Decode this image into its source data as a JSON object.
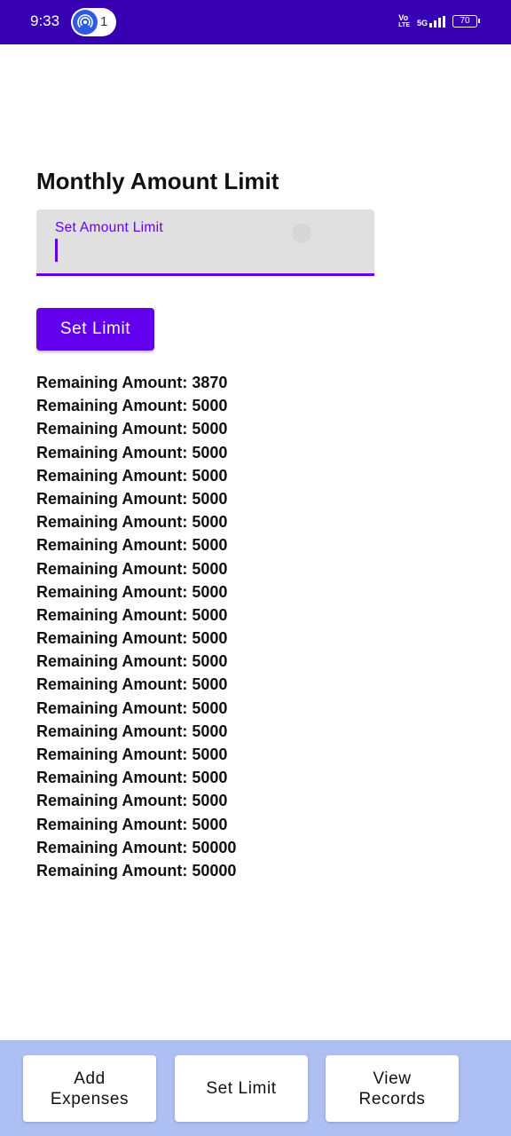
{
  "status_bar": {
    "time": "9:33",
    "notification_count": "1",
    "network_label_top": "Vo",
    "network_label_bottom": "LTE",
    "network_type": "5G",
    "battery": "70"
  },
  "main": {
    "title": "Monthly Amount Limit",
    "amount_field": {
      "label": "Set Amount Limit",
      "value": ""
    },
    "set_limit_button": "Set Limit",
    "records": [
      "Remaining Amount: 3870",
      "Remaining Amount: 5000",
      "Remaining Amount: 5000",
      "Remaining Amount: 5000",
      "Remaining Amount: 5000",
      "Remaining Amount: 5000",
      "Remaining Amount: 5000",
      "Remaining Amount: 5000",
      "Remaining Amount: 5000",
      "Remaining Amount: 5000",
      "Remaining Amount: 5000",
      "Remaining Amount: 5000",
      "Remaining Amount: 5000",
      "Remaining Amount: 5000",
      "Remaining Amount: 5000",
      "Remaining Amount: 5000",
      "Remaining Amount: 5000",
      "Remaining Amount: 5000",
      "Remaining Amount: 5000",
      "Remaining Amount: 5000",
      "Remaining Amount: 50000",
      "Remaining Amount: 50000"
    ]
  },
  "bottom_nav": {
    "add_expenses": [
      "Add",
      "Expenses"
    ],
    "set_limit": [
      "Set Limit"
    ],
    "view_records": [
      "View",
      "Records"
    ]
  },
  "colors": {
    "status_bar": "#3700b3",
    "accent": "#6200ee",
    "bottom_bar": "#aebff3"
  },
  "icons": {
    "notification": "hotspot-icon",
    "signal": "signal-icon",
    "battery": "battery-icon"
  }
}
